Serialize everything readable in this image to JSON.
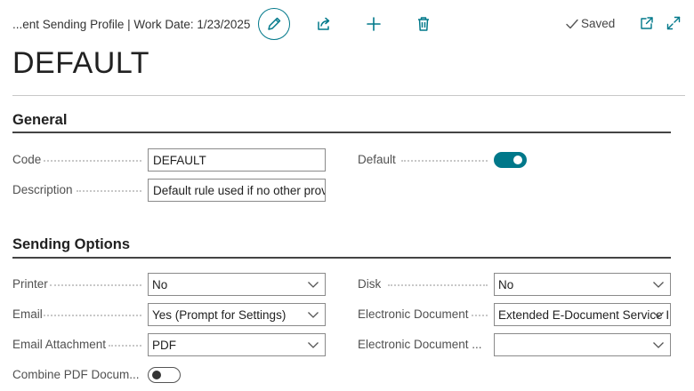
{
  "header": {
    "breadcrumb": "...ent Sending Profile | Work Date: 1/23/2025",
    "status": "Saved"
  },
  "toolbar": {
    "edit_icon": "pencil-icon",
    "share_icon": "share-icon",
    "new_icon": "plus-icon",
    "delete_icon": "trash-icon",
    "popout_icon": "popout-icon",
    "expand_icon": "expand-icon"
  },
  "page": {
    "title": "DEFAULT"
  },
  "general": {
    "title": "General",
    "code": {
      "label": "Code",
      "value": "DEFAULT"
    },
    "description": {
      "label": "Description",
      "value": "Default rule used if no other provi"
    },
    "default": {
      "label": "Default",
      "on": true
    }
  },
  "sending_options": {
    "title": "Sending Options",
    "printer": {
      "label": "Printer",
      "value": "No"
    },
    "email": {
      "label": "Email",
      "value": "Yes (Prompt for Settings)"
    },
    "email_attachment": {
      "label": "Email Attachment",
      "value": "PDF"
    },
    "combine_pdf": {
      "label": "Combine PDF Docum...",
      "on": false
    },
    "disk": {
      "label": "Disk",
      "value": "No"
    },
    "electronic_document": {
      "label": "Electronic Document",
      "value": "Extended E-Document Service I"
    },
    "electronic_document_format": {
      "label": "Electronic Document ...",
      "value": ""
    }
  },
  "colors": {
    "accent": "#00788a",
    "text": "#212121",
    "label": "#505050"
  }
}
